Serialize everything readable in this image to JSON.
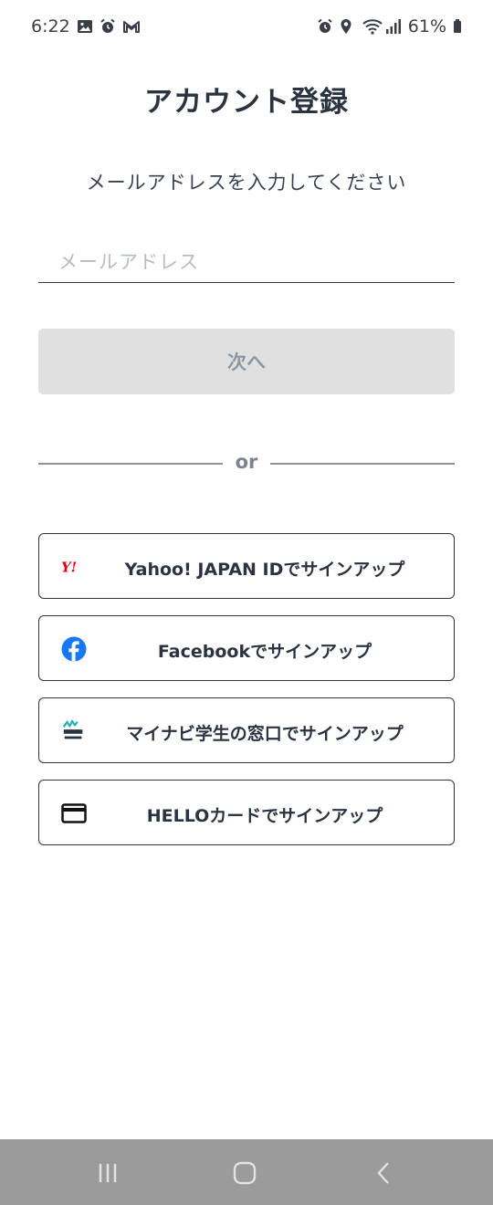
{
  "status_bar": {
    "time": "6:22",
    "battery": "61%",
    "left_icons": [
      "image-icon",
      "alarm-icon",
      "gmail-icon"
    ],
    "right_icons": [
      "alarm-icon",
      "location-icon",
      "wifi-icon",
      "signal-icon",
      "battery-icon"
    ]
  },
  "page": {
    "title": "アカウント登録",
    "subtitle": "メールアドレスを入力してください"
  },
  "email": {
    "placeholder": "メールアドレス",
    "value": ""
  },
  "next_button": {
    "label": "次へ"
  },
  "divider": {
    "label": "or"
  },
  "signup_options": [
    {
      "label": "Yahoo! JAPAN IDでサインアップ",
      "icon": "yahoo-japan-icon"
    },
    {
      "label": "Facebookでサインアップ",
      "icon": "facebook-icon"
    },
    {
      "label": "マイナビ学生の窓口でサインアップ",
      "icon": "mynavi-icon"
    },
    {
      "label": "HELLOカードでサインアップ",
      "icon": "credit-card-icon"
    }
  ],
  "colors": {
    "text": "#2b3340",
    "disabled_button_bg": "#e0e0e0",
    "disabled_button_text": "#8f97a3",
    "yahoo_red": "#e60012",
    "facebook_blue": "#1877f2",
    "nav_bar_bg": "#9b9b9b"
  },
  "nav_bar": {
    "icons": [
      "recent-apps-icon",
      "home-icon",
      "back-icon"
    ]
  }
}
